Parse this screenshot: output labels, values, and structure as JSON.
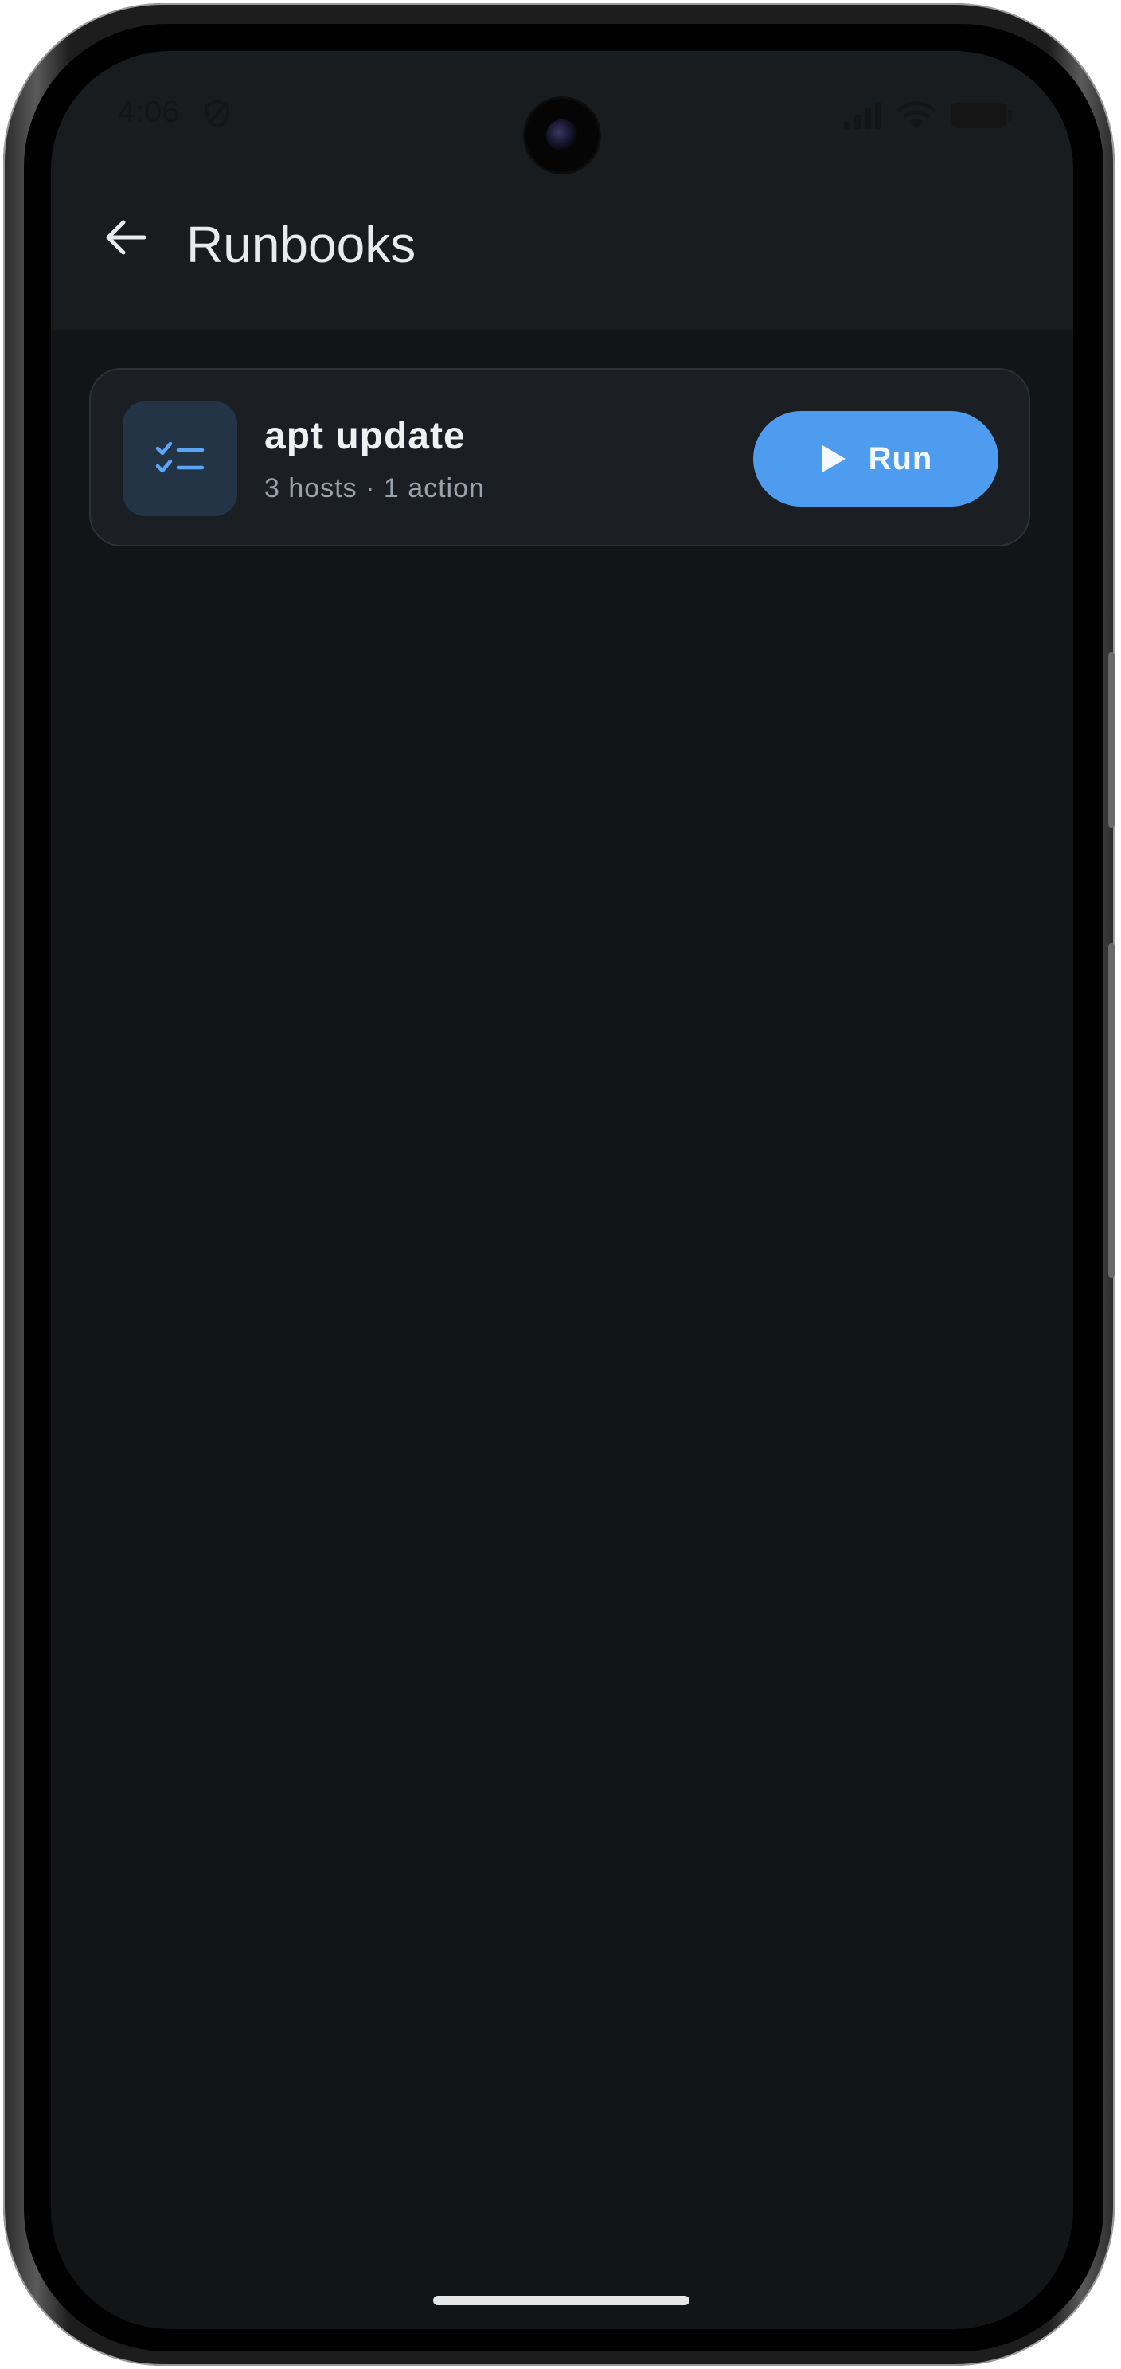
{
  "status_bar": {
    "time": "4:06",
    "icons": [
      "shield-icon",
      "signal-icon",
      "wifi-icon",
      "battery-icon"
    ]
  },
  "app_bar": {
    "back_icon": "arrow-left-icon",
    "title": "Runbooks"
  },
  "runbooks": [
    {
      "icon": "checklist-icon",
      "name": "apt update",
      "summary": "3 hosts · 1 action",
      "action_label": "Run",
      "action_icon": "play-icon"
    }
  ],
  "colors": {
    "background": "#121416",
    "app_bar": "#191c1f",
    "card": "#1b1f24",
    "accent": "#4d9cf0",
    "icon_tile": "#233447"
  }
}
